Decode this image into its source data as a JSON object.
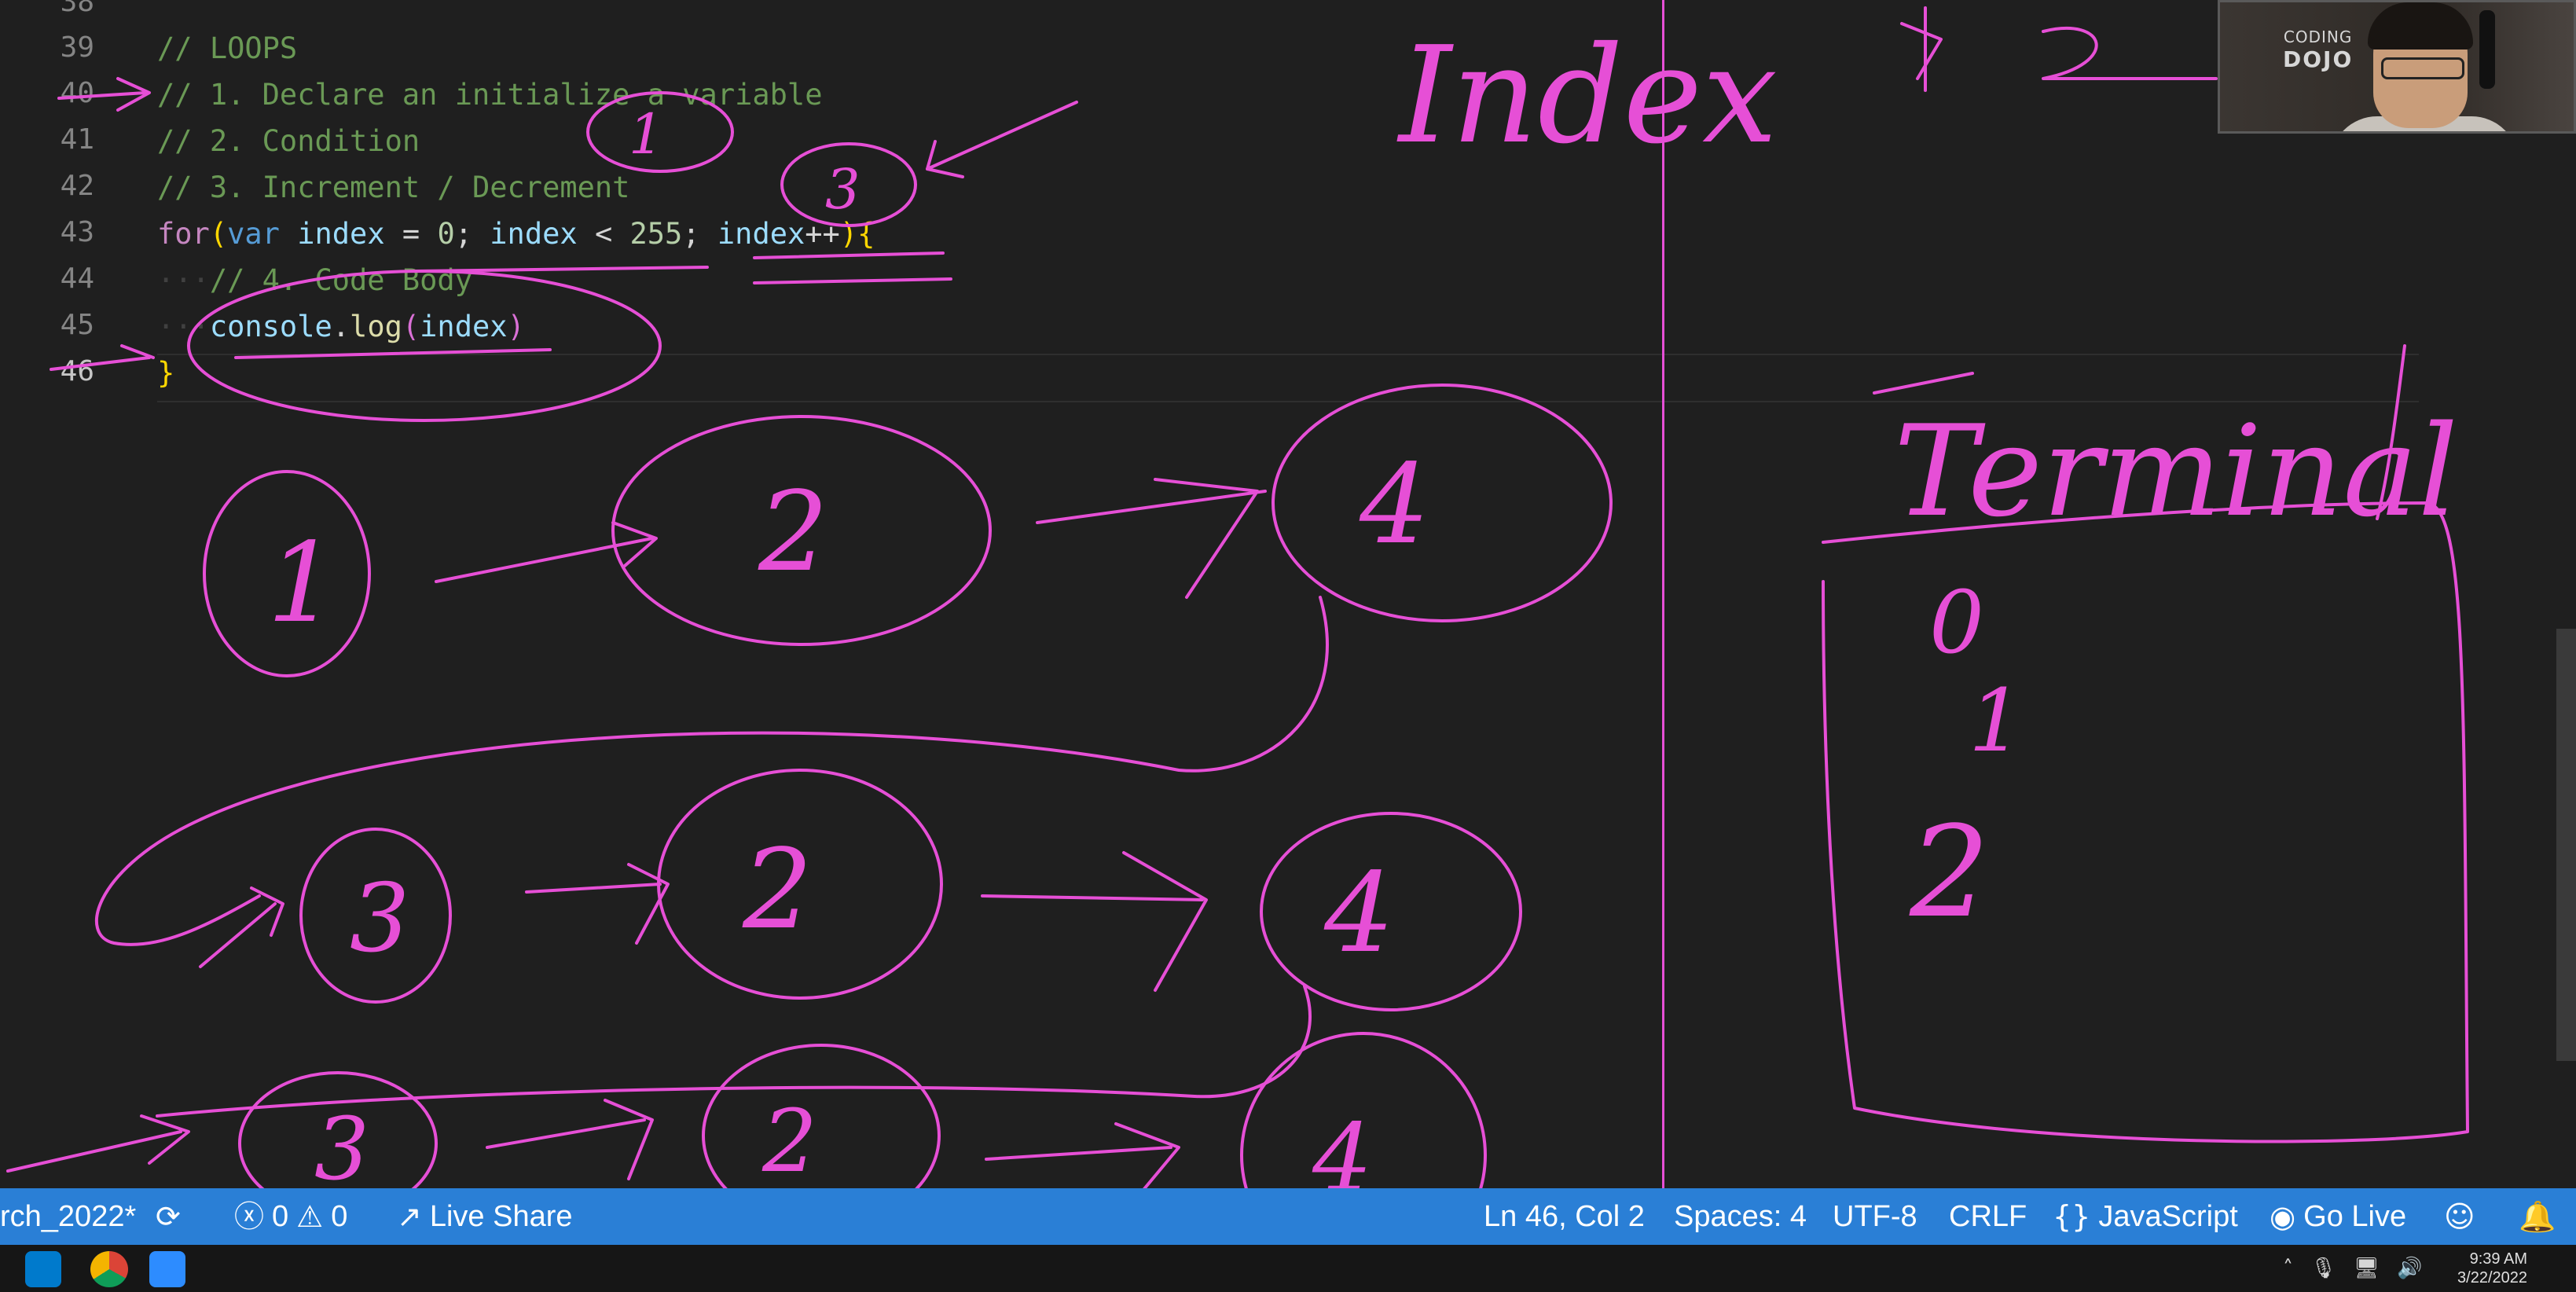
{
  "editor": {
    "lines": [
      {
        "num": "38",
        "text": ""
      },
      {
        "num": "39",
        "text": "// LOOPS"
      },
      {
        "num": "40",
        "text": "// 1. Declare an initialize a variable"
      },
      {
        "num": "41",
        "text": "// 2. Condition"
      },
      {
        "num": "42",
        "text": "// 3. Increment / Decrement"
      },
      {
        "num": "43",
        "text": "for(var index = 0; index < 255; index++){"
      },
      {
        "num": "44",
        "text": "// 4. Code Body"
      },
      {
        "num": "45",
        "text": "console.log(index)"
      },
      {
        "num": "46",
        "text": "}"
      }
    ],
    "tokens": {
      "for_kw": "for",
      "paren_open": "(",
      "var_kw": "var",
      "index_var": "index",
      "eq": " = ",
      "zero": "0",
      "semi1": "; ",
      "index_var2": "index",
      "lt": " < ",
      "limit": "255",
      "semi2": "; ",
      "index_var3": "index",
      "incr": "++",
      "paren_close": ")",
      "brace_open": "{",
      "console": "console",
      "dot": ".",
      "log": "log",
      "log_paren_open": "(",
      "log_arg": "index",
      "log_paren_close": ")",
      "brace_close": "}"
    }
  },
  "webcam": {
    "logo_line1": "CODING",
    "logo_line2": "DOJO"
  },
  "annotations": {
    "index_word": "Index",
    "terminal_word": "Terminal",
    "terminal_values": [
      "0",
      "1",
      "2"
    ],
    "step_numbers": [
      "1",
      "2",
      "4",
      "3",
      "2",
      "4",
      "3",
      "2",
      "4"
    ]
  },
  "statusbar": {
    "branch": "rch_2022*",
    "errors": "0",
    "warnings": "0",
    "live_share": "Live Share",
    "position": "Ln 46, Col 2",
    "spaces": "Spaces: 4",
    "encoding": "UTF-8",
    "eol": "CRLF",
    "language": "JavaScript",
    "go_live": "Go Live"
  },
  "taskbar": {
    "time": "9:39 AM",
    "date": "3/22/2022"
  },
  "colors": {
    "ink": "#e64fd6",
    "statusbar": "#2a7fd6",
    "editor_bg": "#1f1f1f"
  }
}
